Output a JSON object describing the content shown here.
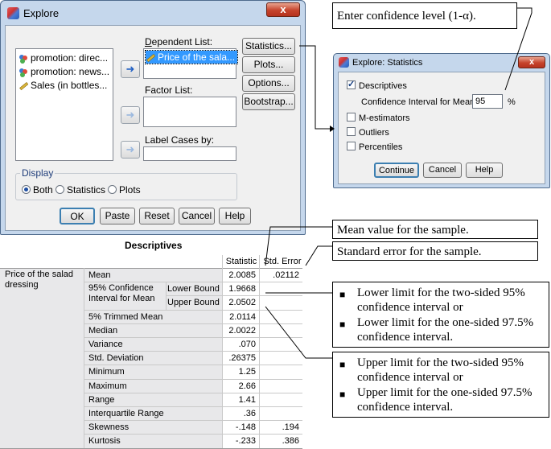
{
  "explore_dialog": {
    "title": "Explore",
    "close_glyph": "x",
    "variables": [
      {
        "label": "promotion: direc...",
        "icon": "nominal-icon"
      },
      {
        "label": "promotion: news...",
        "icon": "nominal-icon"
      },
      {
        "label": "Sales (in bottles...",
        "icon": "scale-icon"
      }
    ],
    "dependent_list_label": "Dependent List:",
    "dependent_items": [
      "Price of the sala..."
    ],
    "factor_list_label": "Factor List:",
    "label_cases_label": "Label Cases by:",
    "side_buttons": [
      "Statistics...",
      "Plots...",
      "Options...",
      "Bootstrap..."
    ],
    "display_group": "Display",
    "display_options": [
      "Both",
      "Statistics",
      "Plots"
    ],
    "display_selected": "Both",
    "bottom_buttons": [
      "OK",
      "Paste",
      "Reset",
      "Cancel",
      "Help"
    ]
  },
  "statistics_dialog": {
    "title": "Explore: Statistics",
    "close_glyph": "x",
    "descriptives_label": "Descriptives",
    "descriptives_checked": true,
    "ci_label": "Confidence Interval for Mean:",
    "ci_value": "95",
    "ci_unit": "%",
    "other_options": [
      "M-estimators",
      "Outliers",
      "Percentiles"
    ],
    "buttons": [
      "Continue",
      "Cancel",
      "Help"
    ]
  },
  "callouts": {
    "confidence": "Enter confidence level (1-α).",
    "mean": "Mean value for the sample.",
    "std_error": "Standard error for the sample.",
    "lower": [
      "Lower limit for the two-sided 95% confidence interval or",
      "Lower limit for the one-sided 97.5% confidence interval."
    ],
    "upper": [
      "Upper limit for the two-sided 95% confidence interval or",
      "Upper limit for the one-sided 97.5% confidence interval."
    ],
    "bullet": "■"
  },
  "descriptives_table": {
    "title": "Descriptives",
    "col_headers": [
      "Statistic",
      "Std. Error"
    ],
    "variable": "Price of the salad dressing",
    "ci_label": "95% Confidence Interval for Mean",
    "rows": [
      {
        "label": "Mean",
        "stat": "2.0085",
        "se": ".02112"
      },
      {
        "label": "Lower Bound",
        "stat": "1.9668",
        "se": ""
      },
      {
        "label": "Upper Bound",
        "stat": "2.0502",
        "se": ""
      },
      {
        "label": "5% Trimmed Mean",
        "stat": "2.0114",
        "se": ""
      },
      {
        "label": "Median",
        "stat": "2.0022",
        "se": ""
      },
      {
        "label": "Variance",
        "stat": ".070",
        "se": ""
      },
      {
        "label": "Std. Deviation",
        "stat": ".26375",
        "se": ""
      },
      {
        "label": "Minimum",
        "stat": "1.25",
        "se": ""
      },
      {
        "label": "Maximum",
        "stat": "2.66",
        "se": ""
      },
      {
        "label": "Range",
        "stat": "1.41",
        "se": ""
      },
      {
        "label": "Interquartile Range",
        "stat": ".36",
        "se": ""
      },
      {
        "label": "Skewness",
        "stat": "-.148",
        "se": ".194"
      },
      {
        "label": "Kurtosis",
        "stat": "-.233",
        "se": ".386"
      }
    ]
  }
}
